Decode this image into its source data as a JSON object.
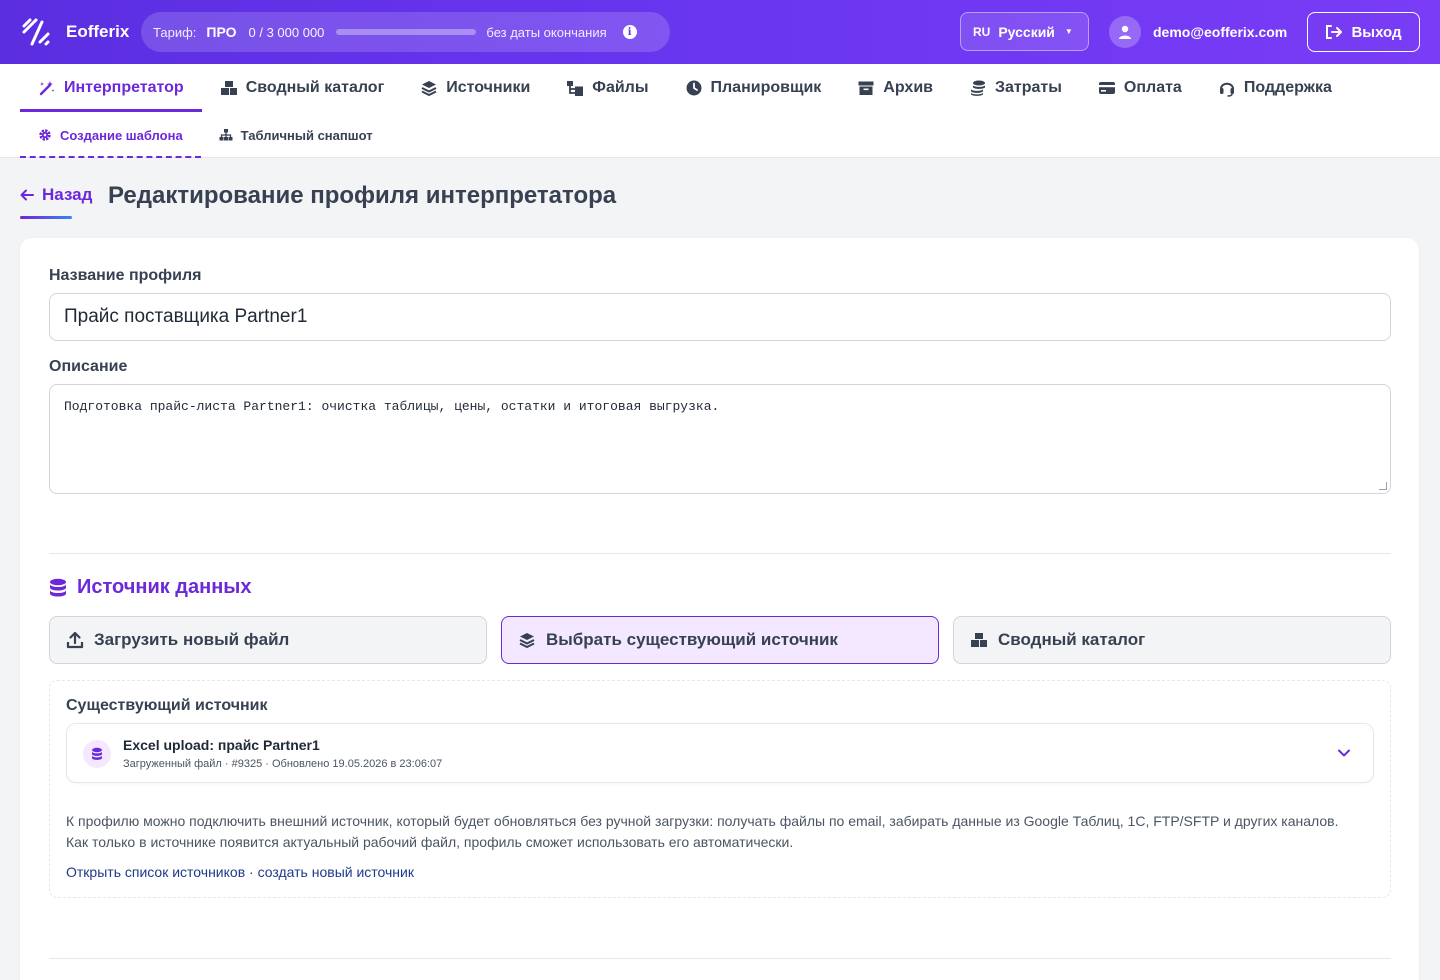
{
  "brand": {
    "name": "Eofferix"
  },
  "tariff": {
    "label": "Тариф:",
    "plan": "ПРО",
    "usage": "0 / 3 000 000",
    "usage_fraction": 0,
    "expiry": "без даты окончания"
  },
  "lang": {
    "code": "RU",
    "name": "Русский"
  },
  "user": {
    "email": "demo@eofferix.com"
  },
  "logout_label": "Выход",
  "nav": {
    "tabs": [
      {
        "label": "Интерпретатор",
        "icon": "magic-wand-icon",
        "active": true
      },
      {
        "label": "Сводный каталог",
        "icon": "boxes-icon"
      },
      {
        "label": "Источники",
        "icon": "layers-icon"
      },
      {
        "label": "Файлы",
        "icon": "folder-tree-icon"
      },
      {
        "label": "Планировщик",
        "icon": "clock-icon"
      },
      {
        "label": "Архив",
        "icon": "archive-icon"
      },
      {
        "label": "Затраты",
        "icon": "coins-icon"
      },
      {
        "label": "Оплата",
        "icon": "credit-card-icon"
      },
      {
        "label": "Поддержка",
        "icon": "headset-icon"
      }
    ],
    "subtabs": [
      {
        "label": "Создание шаблона",
        "icon": "gear-icon",
        "active": true
      },
      {
        "label": "Табличный снапшот",
        "icon": "sitemap-icon"
      }
    ]
  },
  "header": {
    "back_label": "Назад",
    "title": "Редактирование профиля интерпретатора"
  },
  "form": {
    "name_label": "Название профиля",
    "name_value": "Прайс поставщика Partner1",
    "desc_label": "Описание",
    "desc_value": "Подготовка прайс-листа Partner1: очистка таблицы, цены, остатки и итоговая выгрузка."
  },
  "source": {
    "title": "Источник данных",
    "options": [
      {
        "label": "Загрузить новый файл",
        "icon": "upload-icon"
      },
      {
        "label": "Выбрать существующий источник",
        "icon": "layers-icon",
        "active": true
      },
      {
        "label": "Сводный каталог",
        "icon": "boxes-icon"
      }
    ],
    "existing": {
      "title": "Существующий источник",
      "selected_title": "Excel upload: прайс Partner1",
      "selected_meta": "Загруженный файл · #9325 · Обновлено 19.05.2026 в 23:06:07",
      "hint": "К профилю можно подключить внешний источник, который будет обновляться без ручной загрузки: получать файлы по email, забирать данные из Google Таблиц, 1С, FTP/SFTP и других каналов. Как только в источнике появится актуальный рабочий файл, профиль сможет использовать его автоматически.",
      "link_open": "Открыть список источников",
      "link_sep": " · ",
      "link_create": "создать новый источник"
    }
  },
  "colors": {
    "accent": "#6d28d9",
    "topbar_start": "#5b2ee0",
    "topbar_end": "#7a3cf5",
    "link": "#1e3a8a"
  }
}
